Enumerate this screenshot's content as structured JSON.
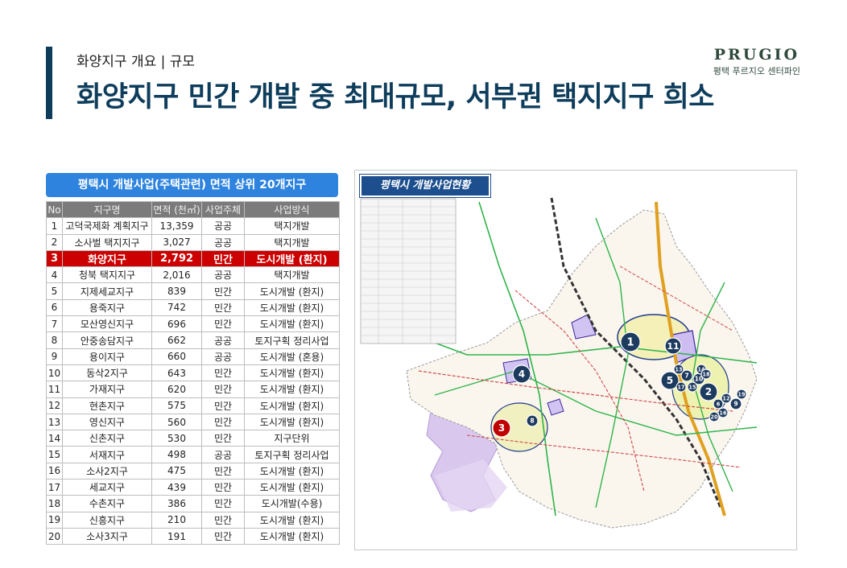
{
  "header": {
    "subtitle": "화양지구 개요 | 규모",
    "headline": "화양지구 민간 개발 중 최대규모, 서부권 택지지구 희소"
  },
  "brand": {
    "logo": "PRUGIO",
    "name": "평택 푸르지오 센터파인"
  },
  "table": {
    "title": "평택시 개발사업(주택관련) 면적 상위 20개지구",
    "columns": [
      "No",
      "지구명",
      "면적 (천㎡)",
      "사업주체",
      "사업방식"
    ],
    "rows": [
      [
        "1",
        "고덕국제화 계획지구",
        "13,359",
        "공공",
        "택지개발"
      ],
      [
        "2",
        "소사벌 택지지구",
        "3,027",
        "공공",
        "택지개발"
      ],
      [
        "3",
        "화양지구",
        "2,792",
        "민간",
        "도시개발 (환지)"
      ],
      [
        "4",
        "청북 택지지구",
        "2,016",
        "공공",
        "택지개발"
      ],
      [
        "5",
        "지제세교지구",
        "839",
        "민간",
        "도시개발 (환지)"
      ],
      [
        "6",
        "용죽지구",
        "742",
        "민간",
        "도시개발 (환지)"
      ],
      [
        "7",
        "모산영신지구",
        "696",
        "민간",
        "도시개발 (환지)"
      ],
      [
        "8",
        "안중송담지구",
        "662",
        "공공",
        "토지구획 정리사업"
      ],
      [
        "9",
        "용이지구",
        "660",
        "공공",
        "도시개발 (혼용)"
      ],
      [
        "10",
        "동삭2지구",
        "643",
        "민간",
        "도시개발 (환지)"
      ],
      [
        "11",
        "가재지구",
        "620",
        "민간",
        "도시개발 (환지)"
      ],
      [
        "12",
        "현촌지구",
        "575",
        "민간",
        "도시개발 (환지)"
      ],
      [
        "13",
        "영신지구",
        "560",
        "민간",
        "도시개발 (환지)"
      ],
      [
        "14",
        "신촌지구",
        "530",
        "민간",
        "지구단위"
      ],
      [
        "15",
        "서재지구",
        "498",
        "공공",
        "토지구획 정리사업"
      ],
      [
        "16",
        "소사2지구",
        "475",
        "민간",
        "도시개발 (환지)"
      ],
      [
        "17",
        "세교지구",
        "439",
        "민간",
        "도시개발 (환지)"
      ],
      [
        "18",
        "수촌지구",
        "386",
        "민간",
        "도시개발(수용)"
      ],
      [
        "19",
        "신흥지구",
        "210",
        "민간",
        "도시개발 (환지)"
      ],
      [
        "20",
        "소사3지구",
        "191",
        "민간",
        "도시개발 (환지)"
      ]
    ],
    "highlight_row": 2,
    "highlight_color": "#cc0000"
  },
  "map": {
    "title": "평택시 개발사업현황",
    "markers": [
      {
        "label": "1",
        "color": "#1d3a5f"
      },
      {
        "label": "2",
        "color": "#1d3a5f"
      },
      {
        "label": "3",
        "color": "#c00000"
      },
      {
        "label": "4",
        "color": "#1d3a5f"
      },
      {
        "label": "5",
        "color": "#1d3a5f"
      },
      {
        "label": "6",
        "color": "#1d3a5f"
      },
      {
        "label": "7",
        "color": "#1d3a5f"
      },
      {
        "label": "8",
        "color": "#1d3a5f"
      },
      {
        "label": "9",
        "color": "#1d3a5f"
      },
      {
        "label": "10",
        "color": "#1d3a5f"
      },
      {
        "label": "11",
        "color": "#1d3a5f"
      },
      {
        "label": "12",
        "color": "#1d3a5f"
      },
      {
        "label": "13",
        "color": "#1d3a5f"
      },
      {
        "label": "14",
        "color": "#1d3a5f"
      },
      {
        "label": "15",
        "color": "#1d3a5f"
      },
      {
        "label": "16",
        "color": "#1d3a5f"
      },
      {
        "label": "17",
        "color": "#1d3a5f"
      },
      {
        "label": "18",
        "color": "#1d3a5f"
      },
      {
        "label": "19",
        "color": "#1d3a5f"
      },
      {
        "label": "20",
        "color": "#1d3a5f"
      }
    ]
  }
}
